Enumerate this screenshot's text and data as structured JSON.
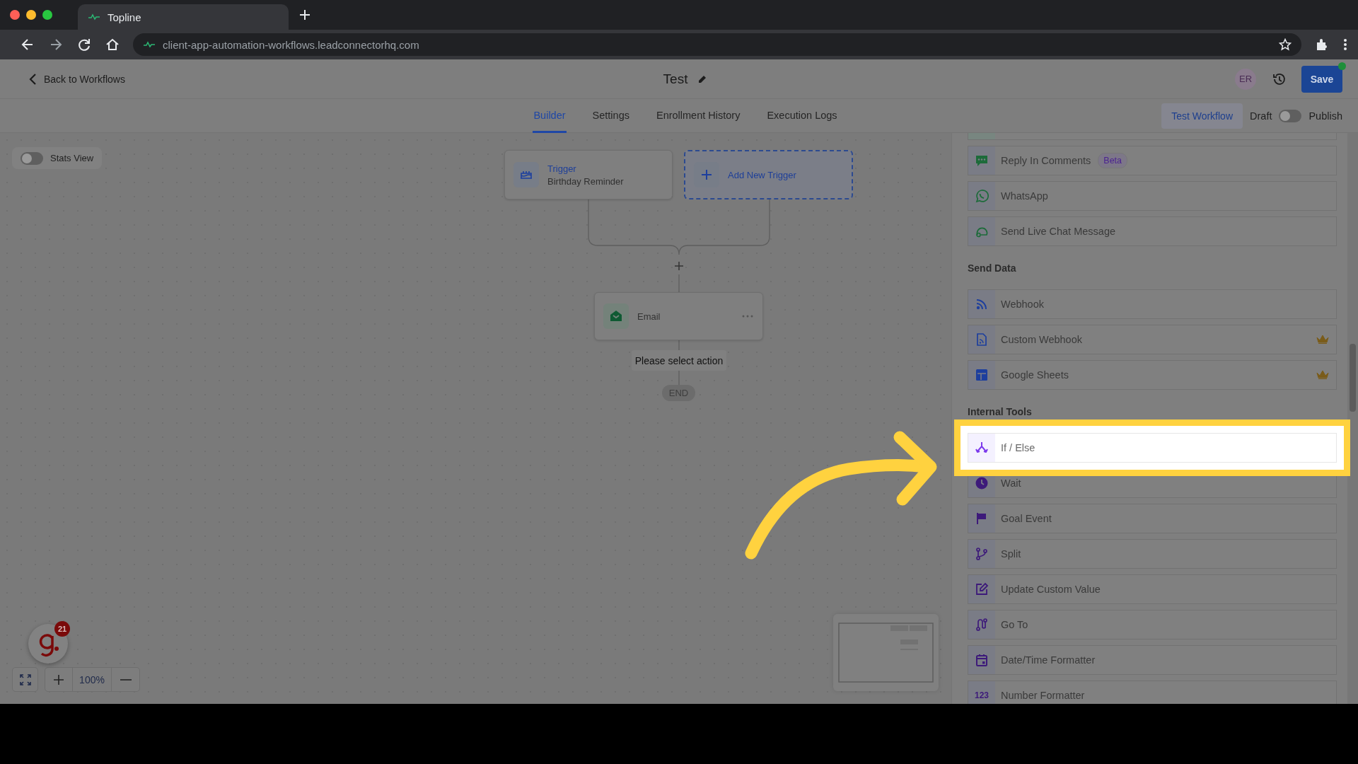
{
  "browser": {
    "tab_title": "Topline",
    "url": "client-app-automation-workflows.leadconnectorhq.com"
  },
  "header": {
    "back_label": "Back to Workflows",
    "title": "Test",
    "avatar": "ER",
    "save": "Save"
  },
  "tabs": [
    {
      "label": "Builder",
      "selected": true
    },
    {
      "label": "Settings",
      "selected": false
    },
    {
      "label": "Enrollment History",
      "selected": false
    },
    {
      "label": "Execution Logs",
      "selected": false
    }
  ],
  "toolbar": {
    "test_workflow": "Test Workflow",
    "draft_label": "Draft",
    "publish": {
      "on": false
    },
    "publish_label": "Publish"
  },
  "stats_view": {
    "label": "Stats View",
    "on": false
  },
  "canvas": {
    "triggers": [
      {
        "kind": "trigger",
        "title": "Trigger",
        "subtitle": "Birthday Reminder"
      },
      {
        "kind": "add",
        "title": "Add New Trigger"
      }
    ],
    "action": {
      "label": "Email"
    },
    "hint": "Please select action",
    "end": "END"
  },
  "zoom": {
    "level_text": "100%"
  },
  "notification_badge": "21",
  "panel": {
    "sections": [
      {
        "items": [
          {
            "label": "Reply In Comments",
            "badge": "Beta",
            "color": "#1d6b3a",
            "premium": false,
            "highlighted": false
          },
          {
            "label": "WhatsApp",
            "color": "#1d6b3a",
            "premium": false,
            "highlighted": false
          },
          {
            "label": "Send Live Chat Message",
            "color": "#1d6b3a",
            "premium": false,
            "highlighted": false
          }
        ]
      },
      {
        "title": "Send Data",
        "items": [
          {
            "label": "Webhook",
            "color": "#1d3f9e",
            "premium": false,
            "highlighted": false
          },
          {
            "label": "Custom Webhook",
            "color": "#1d3f9e",
            "premium": true,
            "highlighted": false
          },
          {
            "label": "Google Sheets",
            "color": "#1d3f9e",
            "premium": true,
            "highlighted": false
          }
        ]
      },
      {
        "title": "Internal Tools",
        "items": [
          {
            "label": "If / Else",
            "color": "#7c3aed",
            "premium": false,
            "highlighted": true
          },
          {
            "label": "Wait",
            "color": "#3d1a7a",
            "premium": false,
            "highlighted": false
          },
          {
            "label": "Goal Event",
            "color": "#3d1a7a",
            "premium": false,
            "highlighted": false
          },
          {
            "label": "Split",
            "color": "#3d1a7a",
            "premium": false,
            "highlighted": false
          },
          {
            "label": "Update Custom Value",
            "color": "#3d1a7a",
            "premium": false,
            "highlighted": false
          },
          {
            "label": "Go To",
            "color": "#3d1a7a",
            "premium": false,
            "highlighted": false
          },
          {
            "label": "Date/Time Formatter",
            "color": "#3d1a7a",
            "premium": false,
            "highlighted": false
          },
          {
            "label": "Number Formatter",
            "icon_text": "123",
            "color": "#3d1a7a",
            "premium": false,
            "highlighted": false
          }
        ]
      }
    ]
  }
}
